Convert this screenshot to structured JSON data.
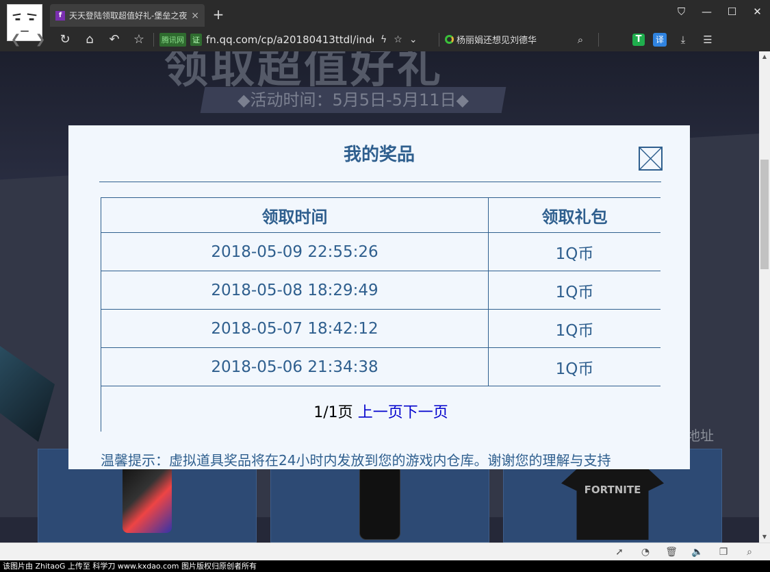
{
  "browser": {
    "tab_title": "天天登陆领取超值好礼-堡垒之夜",
    "tab_favicon": "f",
    "tab_close": "×",
    "new_tab": "+",
    "site_tag": "腾讯网",
    "cert": "证",
    "url": "fn.qq.com/cp/a20180413ttdl/inde",
    "hot_search": "杨丽娟还想见刘德华",
    "translate": "译",
    "t_icon": "T"
  },
  "hero": {
    "title": "领取超值好礼",
    "date": "◆活动时间：5月5日-5月11日◆",
    "address_link": "地址",
    "shirt_text": "FORTNITE"
  },
  "modal": {
    "title": "我的奖品",
    "columns": [
      "领取时间",
      "领取礼包"
    ],
    "rows": [
      {
        "time": "2018-05-09 22:55:26",
        "gift": "1Q币"
      },
      {
        "time": "2018-05-08 18:29:49",
        "gift": "1Q币"
      },
      {
        "time": "2018-05-07 18:42:12",
        "gift": "1Q币"
      },
      {
        "time": "2018-05-06 21:34:38",
        "gift": "1Q币"
      }
    ],
    "pager": {
      "page": "1/1页",
      "prev": "上一页",
      "next": "下一页"
    },
    "tip": "温馨提示：虚拟道具奖品将在24小时内发放到您的游戏内仓库。谢谢您的理解与支持"
  },
  "credit": "该图片由 ZhitaoG 上传至 科学刀 www.kxdao.com 图片版权归原创者所有",
  "colors": {
    "accent": "#2f5f8e",
    "modal_bg": "#f2f7fd",
    "link": "#0000cc"
  }
}
